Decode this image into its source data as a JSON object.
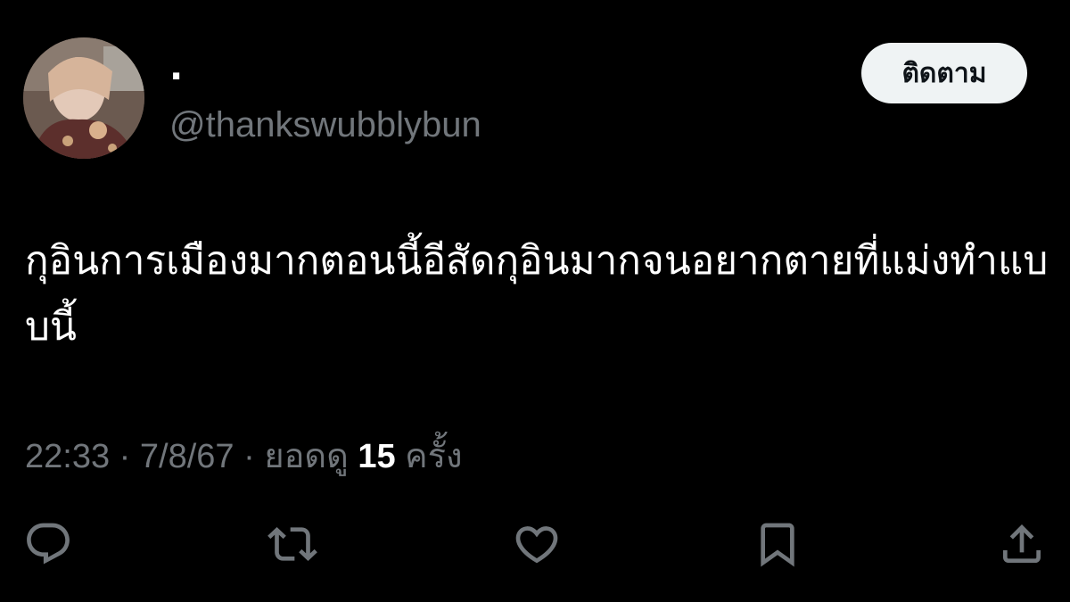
{
  "user": {
    "display_name": "·",
    "handle": "@thankswubblybun",
    "avatar_icon": "user-photo-avatar"
  },
  "follow_button": {
    "label": "ติดตาม"
  },
  "tweet": {
    "text": "กุอินการเมืองมากตอนนี้อีสัดกุอินมากจนอยากตายที่แม่งทำแบบนี้"
  },
  "meta": {
    "time": "22:33",
    "separator": " · ",
    "date": "7/8/67",
    "views_label": "ยอดดู",
    "views_count": "15",
    "views_unit": "ครั้ง"
  },
  "actions": {
    "reply_icon": "reply-icon",
    "retweet_icon": "retweet-icon",
    "like_icon": "heart-icon",
    "bookmark_icon": "bookmark-icon",
    "share_icon": "share-icon"
  },
  "colors": {
    "background": "#000000",
    "text_primary": "#ffffff",
    "text_secondary": "#71767b",
    "button_bg": "#eff3f4",
    "button_text": "#0f1419",
    "icon": "#71767b"
  }
}
